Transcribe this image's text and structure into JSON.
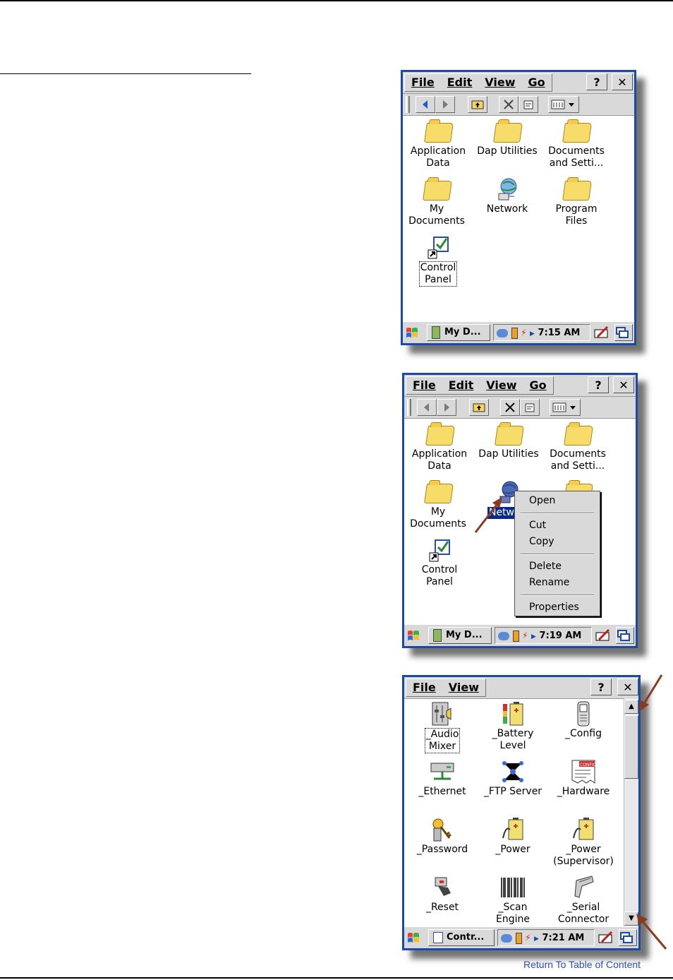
{
  "screens": [
    {
      "menus": [
        "File",
        "Edit",
        "View",
        "Go"
      ],
      "help_label": "?",
      "close_label": "✕",
      "icons": [
        {
          "label": "Application\nData",
          "kind": "folder"
        },
        {
          "label": "Dap Utilities",
          "kind": "folder"
        },
        {
          "label": "Documents\nand Setti...",
          "kind": "folder"
        },
        {
          "label": "My\nDocuments",
          "kind": "folder"
        },
        {
          "label": "Network",
          "kind": "network"
        },
        {
          "label": "Program\nFiles",
          "kind": "folder"
        },
        {
          "label": "Control\nPanel",
          "kind": "control-panel"
        }
      ],
      "task_label": "My D...",
      "clock": "7:15 AM"
    },
    {
      "menus": [
        "File",
        "Edit",
        "View",
        "Go"
      ],
      "help_label": "?",
      "close_label": "✕",
      "icons": [
        {
          "label": "Application\nData",
          "kind": "folder"
        },
        {
          "label": "Dap Utilities",
          "kind": "folder"
        },
        {
          "label": "Documents\nand Setti...",
          "kind": "folder"
        },
        {
          "label": "My\nDocuments",
          "kind": "folder"
        },
        {
          "label": "Netw",
          "kind": "network"
        },
        {
          "label": "Control\nPanel",
          "kind": "control-panel"
        }
      ],
      "context_menu": [
        "Open",
        "Cut",
        "Copy",
        "Delete",
        "Rename",
        "Properties"
      ],
      "task_label": "My D...",
      "clock": "7:19 AM"
    },
    {
      "menus": [
        "File",
        "View"
      ],
      "help_label": "?",
      "close_label": "✕",
      "icons": [
        {
          "label": "_Audio\nMixer",
          "kind": "audio-mixer"
        },
        {
          "label": "_Battery\nLevel",
          "kind": "battery"
        },
        {
          "label": "_Config",
          "kind": "phone"
        },
        {
          "label": "_Ethernet",
          "kind": "ethernet"
        },
        {
          "label": "_FTP Server",
          "kind": "ftp"
        },
        {
          "label": "_Hardware",
          "kind": "config-doc"
        },
        {
          "label": "_Password",
          "kind": "keys"
        },
        {
          "label": "_Power",
          "kind": "power"
        },
        {
          "label": "_Power\n(Supervisor)",
          "kind": "power"
        },
        {
          "label": "_Reset",
          "kind": "reset"
        },
        {
          "label": "_Scan\nEngine",
          "kind": "barcode"
        },
        {
          "label": "_Serial\nConnector",
          "kind": "scanner"
        }
      ],
      "config_tag": "CONFIG",
      "task_label": "Contr...",
      "clock": "7:21 AM"
    }
  ],
  "footer_link": "Return To Table of Content",
  "colors": {
    "window_border": "#1a4aa8",
    "arrow": "#8b3a1e",
    "link": "#2a4fb8"
  }
}
